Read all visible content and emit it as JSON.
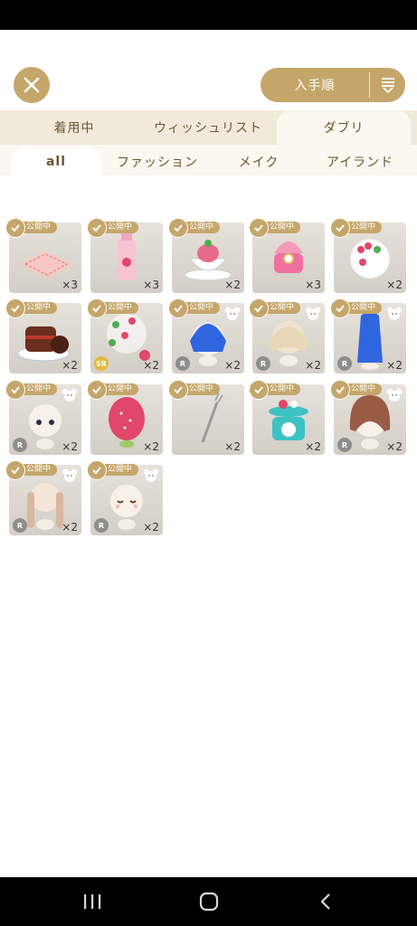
{
  "header": {
    "close_icon": "close-x-icon",
    "sort_label": "入手順",
    "sort_icon": "sort-list-icon"
  },
  "tabs": [
    {
      "label": "着用中",
      "active": false
    },
    {
      "label": "ウィッシュリスト",
      "active": false
    },
    {
      "label": "ダブリ",
      "active": true
    }
  ],
  "subtabs": [
    {
      "label": "all",
      "active": true
    },
    {
      "label": "ファッション",
      "active": false
    },
    {
      "label": "メイク",
      "active": false
    },
    {
      "label": "アイランド",
      "active": false
    }
  ],
  "badge_text": "公開中",
  "colors": {
    "accent": "#c5a66a",
    "tab_bg": "#f2ead9",
    "text": "#6b5535"
  },
  "items": [
    {
      "art": "picnic-blanket",
      "qty": "×3",
      "bear": false,
      "rarity": ""
    },
    {
      "art": "strawberry-drink",
      "qty": "×3",
      "bear": false,
      "rarity": ""
    },
    {
      "art": "strawberry-teacup",
      "qty": "×2",
      "bear": false,
      "rarity": ""
    },
    {
      "art": "ring-box",
      "qty": "×3",
      "bear": false,
      "rarity": ""
    },
    {
      "art": "strawberry-wreath",
      "qty": "×2",
      "bear": false,
      "rarity": ""
    },
    {
      "art": "chocolate-cake",
      "qty": "×2",
      "bear": false,
      "rarity": ""
    },
    {
      "art": "strawberry-plant",
      "qty": "×2",
      "bear": false,
      "rarity": "SR"
    },
    {
      "art": "blue-hair",
      "qty": "×2",
      "bear": true,
      "rarity": "R"
    },
    {
      "art": "beige-hair",
      "qty": "×2",
      "bear": true,
      "rarity": "R"
    },
    {
      "art": "blue-long-hair",
      "qty": "×2",
      "bear": true,
      "rarity": "R"
    },
    {
      "art": "doll-face-eyes",
      "qty": "×2",
      "bear": true,
      "rarity": "R"
    },
    {
      "art": "strawberry-hat",
      "qty": "×2",
      "bear": false,
      "rarity": ""
    },
    {
      "art": "silver-fork",
      "qty": "×2",
      "bear": false,
      "rarity": ""
    },
    {
      "art": "kitchen-scale",
      "qty": "×2",
      "bear": false,
      "rarity": ""
    },
    {
      "art": "brown-bob-hair",
      "qty": "×2",
      "bear": true,
      "rarity": "R"
    },
    {
      "art": "pigtail-hair",
      "qty": "×2",
      "bear": true,
      "rarity": "R"
    },
    {
      "art": "doll-face-blush",
      "qty": "×2",
      "bear": true,
      "rarity": "R"
    }
  ],
  "nav": {
    "recent_icon": "recent-apps-icon",
    "home_icon": "home-icon",
    "back_icon": "back-icon"
  }
}
